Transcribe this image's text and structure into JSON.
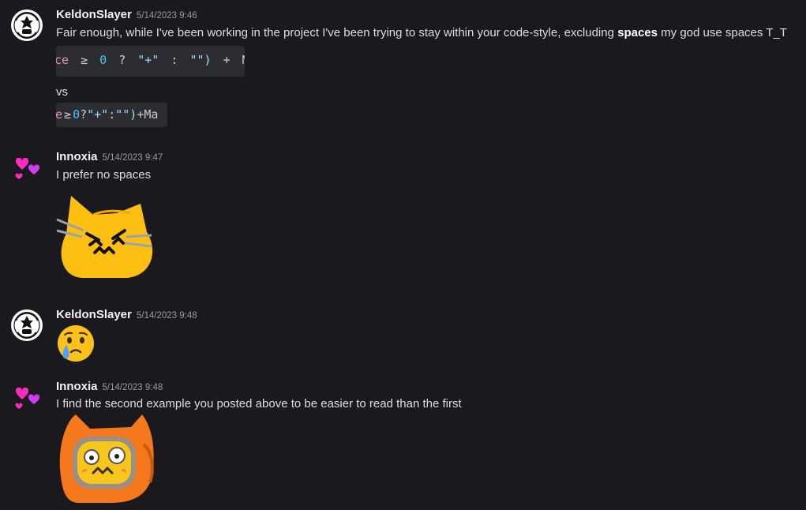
{
  "messages": [
    {
      "author": "KeldonSlayer",
      "timestamp": "5/14/2023 9:46",
      "text_before": "Fair enough, while I've been working in the project I've been trying to stay within your code-style, excluding ",
      "text_bold": "spaces",
      "text_after": " my god use spaces T_T",
      "code1": [
        "ce",
        "≥",
        "0",
        "?",
        "\"+\"",
        ":",
        "\"\")",
        "+",
        "Ma"
      ],
      "vs_text": "vs",
      "code2": [
        "e",
        "≥",
        "0",
        "?",
        "\"+\"",
        ":",
        "\"\")",
        "+",
        "Ma"
      ]
    },
    {
      "author": "Innoxia",
      "timestamp": "5/14/2023 9:47",
      "text": "I prefer no spaces",
      "sticker": "angry-cat-emoji"
    },
    {
      "author": "KeldonSlayer",
      "timestamp": "5/14/2023 9:48",
      "emoji": "crying-face-emoji"
    },
    {
      "author": "Innoxia",
      "timestamp": "5/14/2023 9:48",
      "text": "I find the second example you posted above to be easier to read than the first",
      "sticker": "hooded-cat-emoji"
    }
  ],
  "colors": {
    "background": "#1a1a1e",
    "username": "#f2f3f5",
    "timestamp": "#949ba4",
    "text": "#dbdee1"
  }
}
